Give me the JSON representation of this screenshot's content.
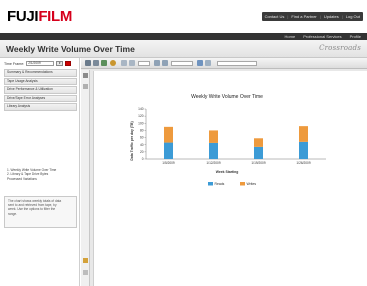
{
  "brand": {
    "logo_prefix": "FUJI",
    "logo_highlight": "FILM"
  },
  "top_links": [
    "Contact Us",
    "Find a Partner",
    "Updates",
    "Log Out"
  ],
  "nav": [
    "Home",
    "Professional Services",
    "Profile"
  ],
  "page": {
    "title": "Weekly Write Volume Over Time",
    "product_logo": "Crossroads"
  },
  "left_panel": {
    "time_frame_label": "Time Frame:",
    "time_frame_value": "2/1/2009",
    "menu_items": [
      "Summary & Recommendations",
      "Tape Usage Analysis",
      "Drive Performance & Utilization",
      "Drive/Tape Error Analyses",
      "Library Analysis"
    ],
    "sub_links": [
      "1. Weekly Write Volume Over Time",
      "2. Library & Tape Drive Bytes",
      "   Processed Variations"
    ],
    "info_text": [
      "The chart shows weekly totals of data",
      "sent to and retrieved from tape, by",
      "week. Use the options to filter the",
      "range."
    ]
  },
  "colors": {
    "reads": "#3c9bd6",
    "writes": "#ee9a3d",
    "nav_bg": "#333333"
  },
  "chart_data": {
    "type": "bar",
    "stacked": true,
    "title": "Weekly Write Volume Over Time",
    "xlabel": "Week Starting",
    "ylabel": "Data Traffic per day (TB)",
    "categories": [
      "1/5/2009",
      "1/12/2009",
      "1/19/2009",
      "1/26/2009"
    ],
    "series": [
      {
        "name": "Reads",
        "color": "#3c9bd6",
        "values": [
          46,
          45,
          34,
          48
        ]
      },
      {
        "name": "Writes",
        "color": "#ee9a3d",
        "values": [
          44,
          35,
          24,
          44
        ]
      }
    ],
    "ylim": [
      0,
      140
    ],
    "yticks": [
      0,
      20,
      40,
      60,
      80,
      100,
      120,
      140
    ],
    "legend_position": "bottom",
    "grid": false
  }
}
